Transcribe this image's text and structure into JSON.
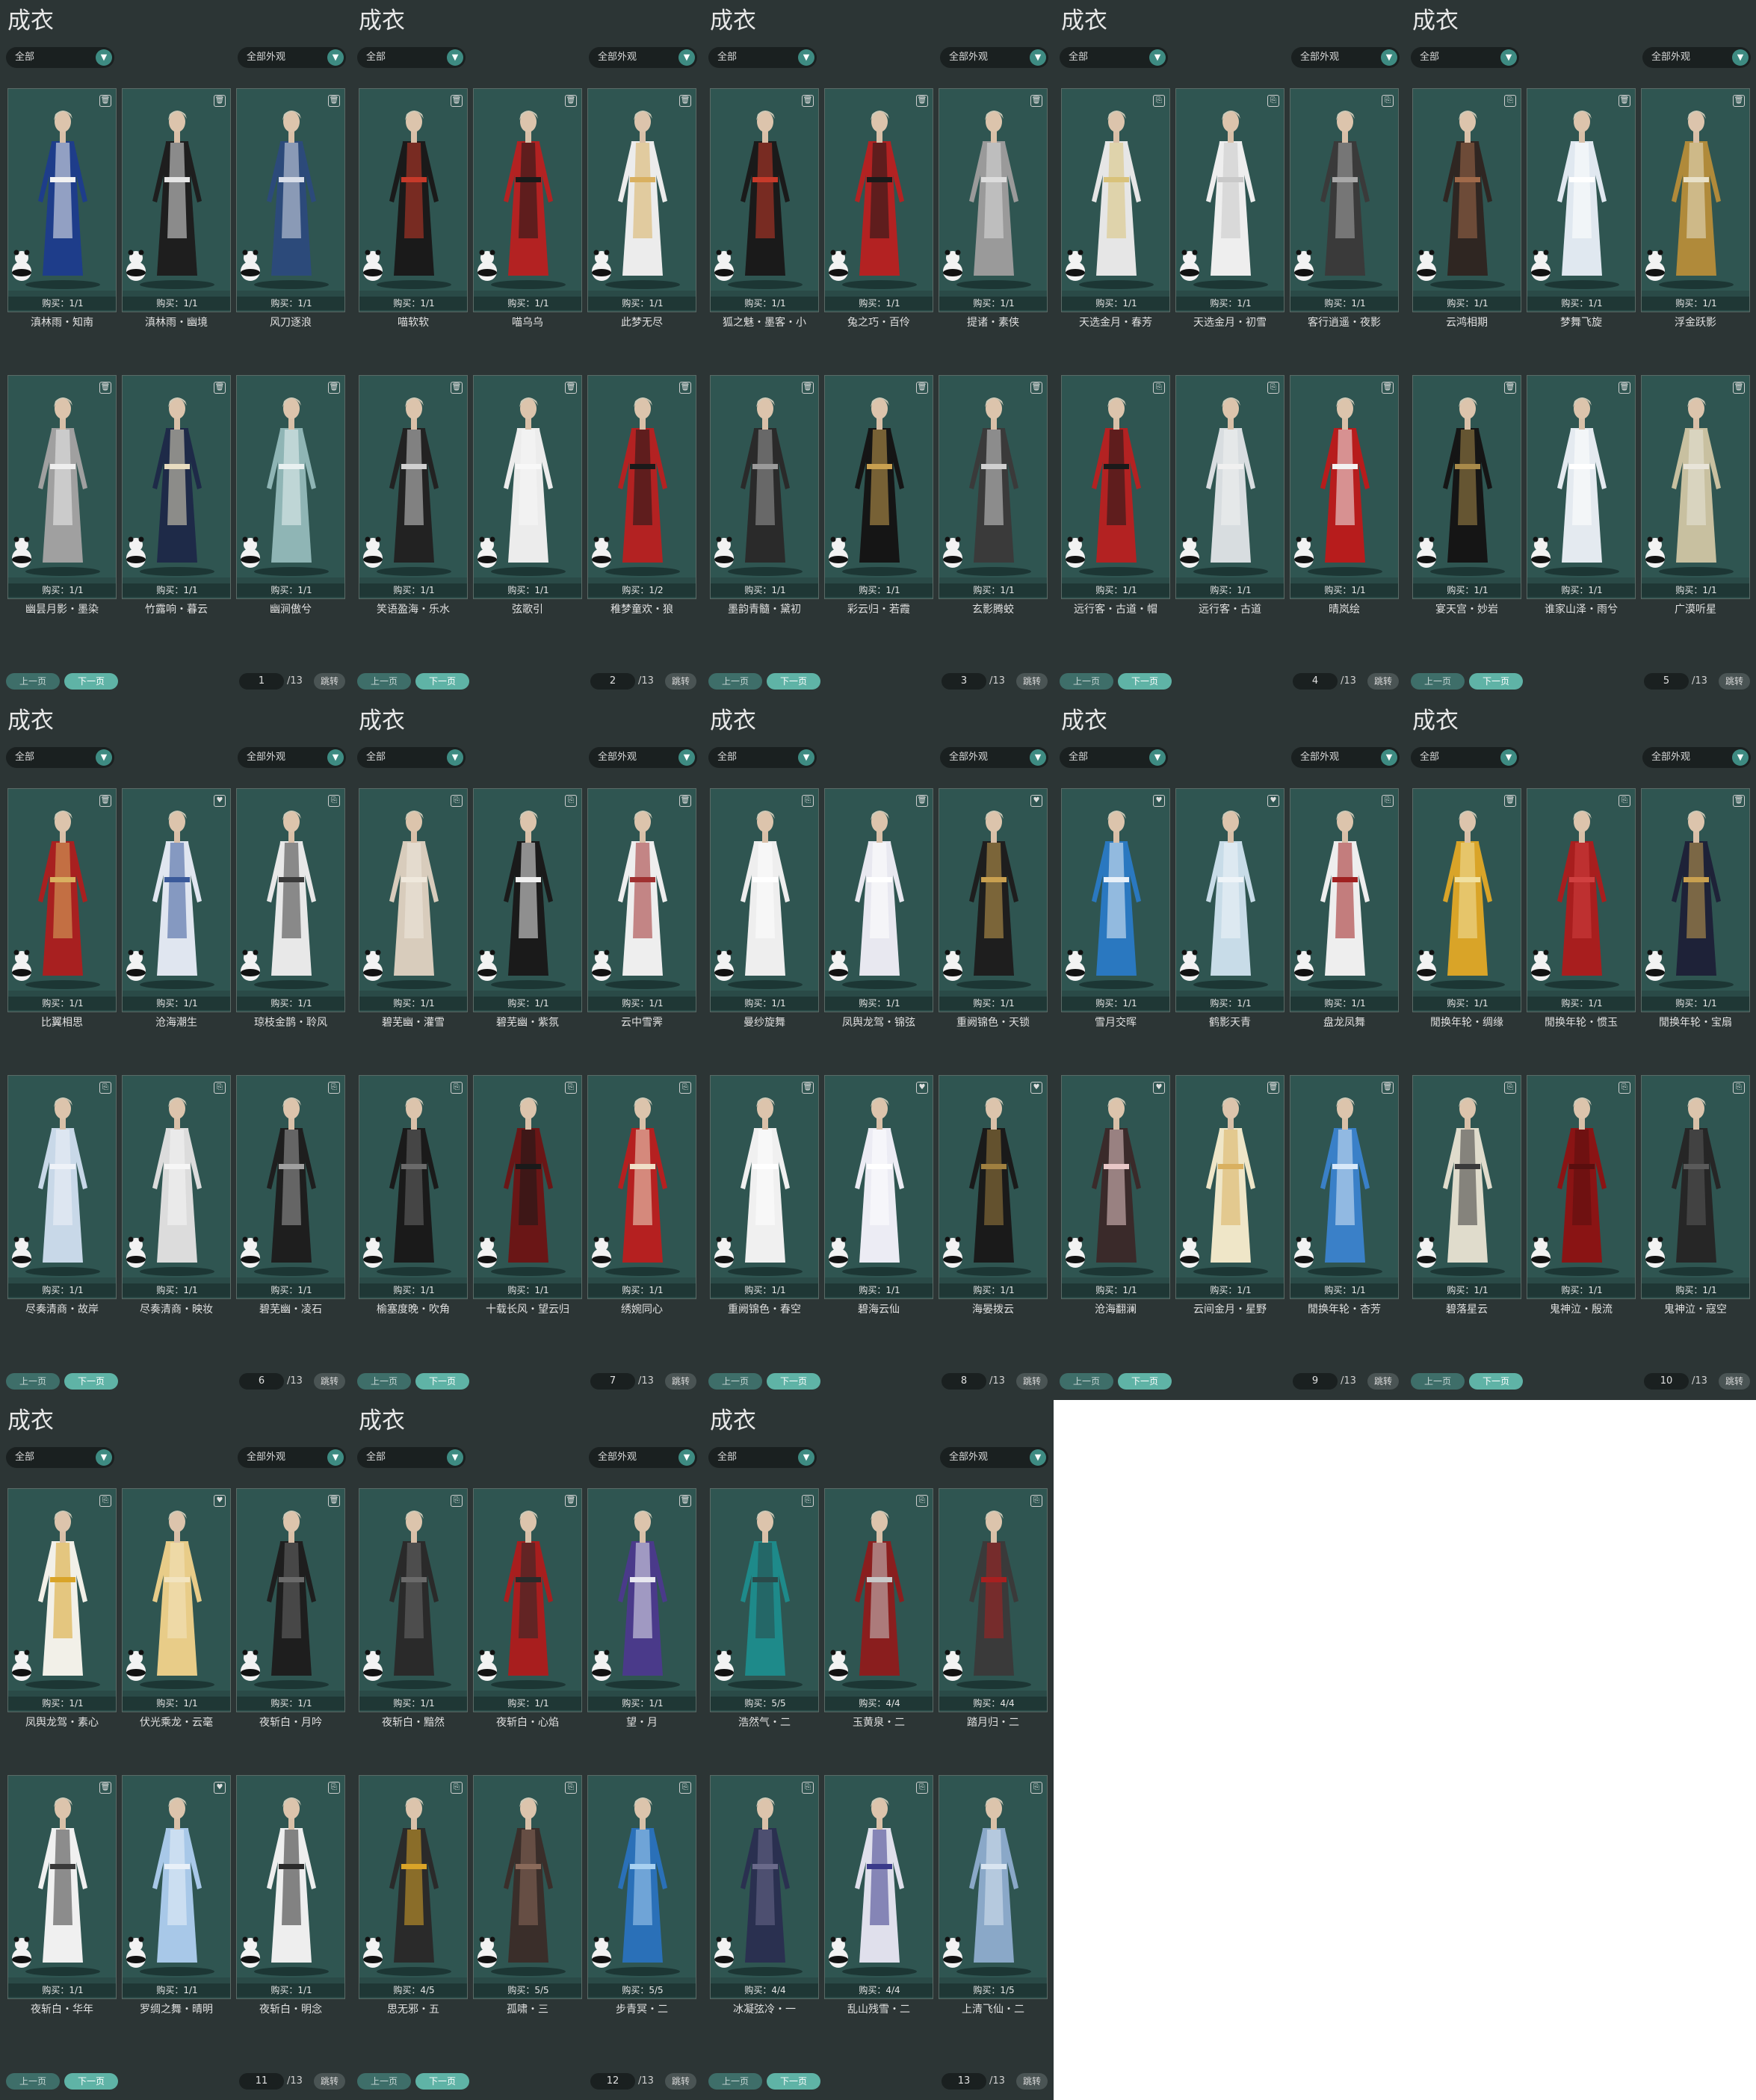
{
  "panel_title": "成衣",
  "filter_left": "全部",
  "filter_right": "全部外观",
  "prev_label": "上一页",
  "next_label": "下一页",
  "jump_label": "跳转",
  "total_pages": "/13",
  "pages": [
    {
      "page": "1",
      "items": [
        {
          "name": "滇林雨・知南",
          "buy": "购买：1/1",
          "outfit": "#1e3d8a",
          "accent": "#f2f2f2",
          "icon": "trash-icon"
        },
        {
          "name": "滇林雨・幽境",
          "buy": "购买：1/1",
          "outfit": "#1e1e1e",
          "accent": "#e5e5e5",
          "icon": "trash-icon"
        },
        {
          "name": "风刀逐浪",
          "buy": "购买：1/1",
          "outfit": "#2c4a7a",
          "accent": "#d8dde8",
          "icon": "trash-icon"
        },
        {
          "name": "幽昙月影・墨染",
          "buy": "购买：1/1",
          "outfit": "#a0a0a0",
          "accent": "#eeeeee",
          "icon": "trash-icon"
        },
        {
          "name": "竹露响・暮云",
          "buy": "购买：1/1",
          "outfit": "#1e2a48",
          "accent": "#e8dcc0",
          "icon": "trash-icon"
        },
        {
          "name": "幽涧傲兮",
          "buy": "购买：1/1",
          "outfit": "#8fb5b5",
          "accent": "#e8f0f0",
          "icon": "trash-icon"
        }
      ]
    },
    {
      "page": "2",
      "items": [
        {
          "name": "喵软软",
          "buy": "购买：1/1",
          "outfit": "#1a1a1a",
          "accent": "#c63a2a",
          "icon": "trash-icon"
        },
        {
          "name": "喵乌乌",
          "buy": "购买：1/1",
          "outfit": "#b32222",
          "accent": "#1a1a1a",
          "icon": "trash-icon"
        },
        {
          "name": "此梦无尽",
          "buy": "购买：1/1",
          "outfit": "#ececec",
          "accent": "#d9b060",
          "icon": "trash-icon"
        },
        {
          "name": "笑语盈海・乐水",
          "buy": "购买：1/1",
          "outfit": "#222222",
          "accent": "#d0d0d0",
          "icon": "trash-icon"
        },
        {
          "name": "弦歌引",
          "buy": "购买：1/1",
          "outfit": "#ececec",
          "accent": "#f8f8f8",
          "icon": "trash-icon"
        },
        {
          "name": "稚梦童欢・狼",
          "buy": "购买：1/2",
          "outfit": "#b32222",
          "accent": "#1a1a1a",
          "icon": "trash-icon"
        }
      ]
    },
    {
      "page": "3",
      "items": [
        {
          "name": "狐之魅・墨客・小",
          "buy": "购买：1/1",
          "outfit": "#1a1a1a",
          "accent": "#c63a2a",
          "icon": "trash-icon"
        },
        {
          "name": "兔之巧・百伶",
          "buy": "购买：1/1",
          "outfit": "#b32222",
          "accent": "#1a1a1a",
          "icon": "trash-icon"
        },
        {
          "name": "提诸・素侠",
          "buy": "购买：1/1",
          "outfit": "#9a9a9a",
          "accent": "#dcdcdc",
          "icon": "trash-icon"
        },
        {
          "name": "墨韵青髓・黛初",
          "buy": "购买：1/1",
          "outfit": "#2a2a2a",
          "accent": "#9a9a9a",
          "icon": "trash-icon"
        },
        {
          "name": "彩云归・若霞",
          "buy": "购买：1/1",
          "outfit": "#151515",
          "accent": "#c9a050",
          "icon": "trash-icon"
        },
        {
          "name": "玄影腾蛟",
          "buy": "购买：1/1",
          "outfit": "#3a3a3a",
          "accent": "#d0d0d0",
          "icon": "trash-icon"
        }
      ]
    },
    {
      "page": "4",
      "items": [
        {
          "name": "天选金月・春芳",
          "buy": "购买：1/1",
          "outfit": "#e6e6e6",
          "accent": "#d9c27a",
          "icon": "tag-icon"
        },
        {
          "name": "天选金月・初雪",
          "buy": "购买：1/1",
          "outfit": "#eeeeee",
          "accent": "#c9c9c9",
          "icon": "tag-icon"
        },
        {
          "name": "客行逍遥・夜影",
          "buy": "购买：1/1",
          "outfit": "#3a3a3a",
          "accent": "#a8a8a8",
          "icon": "tag-icon"
        },
        {
          "name": "远行客・古道・帽",
          "buy": "购买：1/1",
          "outfit": "#b32222",
          "accent": "#1a1a1a",
          "icon": "tag-icon"
        },
        {
          "name": "远行客・古道",
          "buy": "购买：1/1",
          "outfit": "#d8dde0",
          "accent": "#f0f0f0",
          "icon": "tag-icon"
        },
        {
          "name": "晴岚绘",
          "buy": "购买：1/1",
          "outfit": "#b71c1c",
          "accent": "#f2f2f2",
          "icon": "trash-icon"
        }
      ]
    },
    {
      "page": "5",
      "items": [
        {
          "name": "云鸿相期",
          "buy": "购买：1/1",
          "outfit": "#2f2622",
          "accent": "#a06a4a",
          "icon": "tag-icon"
        },
        {
          "name": "梦舞飞旋",
          "buy": "购买：1/1",
          "outfit": "#e0e8f0",
          "accent": "#ffffff",
          "icon": "trash-icon"
        },
        {
          "name": "浮金跃影",
          "buy": "购买：1/1",
          "outfit": "#b08a3a",
          "accent": "#e8e0c8",
          "icon": "trash-icon"
        },
        {
          "name": "宴天宫・妙岩",
          "buy": "购买：1/1",
          "outfit": "#151515",
          "accent": "#a88a4a",
          "icon": "trash-icon"
        },
        {
          "name": "谁家山泽・雨兮",
          "buy": "购买：1/1",
          "outfit": "#e4eaf0",
          "accent": "#ffffff",
          "icon": "trash-icon"
        },
        {
          "name": "广漠听星",
          "buy": "购买：1/1",
          "outfit": "#c8c0a0",
          "accent": "#e8e4d8",
          "icon": "trash-icon"
        }
      ]
    },
    {
      "page": "6",
      "items": [
        {
          "name": "比翼相思",
          "buy": "购买：1/1",
          "outfit": "#a82020",
          "accent": "#d9b060",
          "icon": "trash-icon"
        },
        {
          "name": "沧海潮生",
          "buy": "购买：1/1",
          "outfit": "#e0e6f0",
          "accent": "#3a5a9a",
          "icon": "heart-icon"
        },
        {
          "name": "琼枝金鹊・聆风",
          "buy": "购买：1/1",
          "outfit": "#e8e8e8",
          "accent": "#3a3a3a",
          "icon": "tag-icon"
        },
        {
          "name": "尽奏清商・故岸",
          "buy": "购买：1/1",
          "outfit": "#c8d8e8",
          "accent": "#eef2f8",
          "icon": "tag-icon"
        },
        {
          "name": "尽奏清商・映妆",
          "buy": "购买：1/1",
          "outfit": "#dcdcdc",
          "accent": "#f6f6f6",
          "icon": "tag-icon"
        },
        {
          "name": "碧芜幽・凌石",
          "buy": "购买：1/1",
          "outfit": "#1e1e1e",
          "accent": "#a0a0a0",
          "icon": "tag-icon"
        }
      ]
    },
    {
      "page": "7",
      "items": [
        {
          "name": "碧芜幽・灌雪",
          "buy": "购买：1/1",
          "outfit": "#d8ccbc",
          "accent": "#efe8dc",
          "icon": "tag-icon"
        },
        {
          "name": "碧芜幽・紫氛",
          "buy": "购买：1/1",
          "outfit": "#1a1a1a",
          "accent": "#f0f0f0",
          "icon": "tag-icon"
        },
        {
          "name": "云中雪霁",
          "buy": "购买：1/1",
          "outfit": "#eeeeee",
          "accent": "#a03030",
          "icon": "trash-icon"
        },
        {
          "name": "榆塞度晚・吹角",
          "buy": "购买：1/1",
          "outfit": "#1a1a1a",
          "accent": "#6a6a6a",
          "icon": "tag-icon"
        },
        {
          "name": "十载长风・望云归",
          "buy": "购买：1/1",
          "outfit": "#6a1616",
          "accent": "#1a1a1a",
          "icon": "tag-icon"
        },
        {
          "name": "绣婉同心",
          "buy": "购买：1/1",
          "outfit": "#b52020",
          "accent": "#efe0c8",
          "icon": "tag-icon"
        }
      ]
    },
    {
      "page": "8",
      "items": [
        {
          "name": "曼纱旋舞",
          "buy": "购买：1/1",
          "outfit": "#eeeeee",
          "accent": "#ffffff",
          "icon": "tag-icon"
        },
        {
          "name": "凤舆龙驾・锦弦",
          "buy": "购买：1/1",
          "outfit": "#e8e8f0",
          "accent": "#ffffff",
          "icon": "trash-icon"
        },
        {
          "name": "重阙锦色・天锁",
          "buy": "购买：1/1",
          "outfit": "#1e1e1e",
          "accent": "#c9a050",
          "icon": "heart-icon"
        },
        {
          "name": "重阙锦色・春空",
          "buy": "购买：1/1",
          "outfit": "#f0f0f0",
          "accent": "#ffffff",
          "icon": "trash-icon"
        },
        {
          "name": "碧海云仙",
          "buy": "购买：1/1",
          "outfit": "#ececf4",
          "accent": "#ffffff",
          "icon": "heart-icon"
        },
        {
          "name": "海晏拨云",
          "buy": "购买：1/1",
          "outfit": "#1a1a1a",
          "accent": "#a08040",
          "icon": "heart-icon"
        }
      ]
    },
    {
      "page": "9",
      "items": [
        {
          "name": "雪月交晖",
          "buy": "购买：1/1",
          "outfit": "#2a78c0",
          "accent": "#e8f0f8",
          "icon": "heart-icon"
        },
        {
          "name": "鹤影天青",
          "buy": "购买：1/1",
          "outfit": "#c8dce8",
          "accent": "#eef4f8",
          "icon": "heart-icon"
        },
        {
          "name": "盘龙凤舞",
          "buy": "购买：1/1",
          "outfit": "#eeeeee",
          "accent": "#a02020",
          "icon": "tag-icon"
        },
        {
          "name": "沧海翻澜",
          "buy": "购买：1/1",
          "outfit": "#3a2a2a",
          "accent": "#e8c8c8",
          "icon": "heart-icon"
        },
        {
          "name": "云间金月・星野",
          "buy": "购买：1/1",
          "outfit": "#efe6c8",
          "accent": "#d9b060",
          "icon": "trash-icon"
        },
        {
          "name": "閒换年轮・杏芳",
          "buy": "购买：1/1",
          "outfit": "#3a80c8",
          "accent": "#d8e8f8",
          "icon": "trash-icon"
        }
      ]
    },
    {
      "page": "10",
      "items": [
        {
          "name": "閒换年轮・绸缘",
          "buy": "购买：1/1",
          "outfit": "#d9a428",
          "accent": "#f0e0a0",
          "icon": "trash-icon"
        },
        {
          "name": "閒换年轮・惯玉",
          "buy": "购买：1/1",
          "outfit": "#a81e1e",
          "accent": "#d04040",
          "icon": "tag-icon"
        },
        {
          "name": "閒换年轮・宝扇",
          "buy": "购买：1/1",
          "outfit": "#1e2238",
          "accent": "#c9a050",
          "icon": "trash-icon"
        },
        {
          "name": "碧落星云",
          "buy": "购买：1/1",
          "outfit": "#e0dccc",
          "accent": "#3a3a3a",
          "icon": "tag-icon"
        },
        {
          "name": "鬼神泣・殷流",
          "buy": "购买：1/1",
          "outfit": "#8a1414",
          "accent": "#5a0e0e",
          "icon": "tag-icon"
        },
        {
          "name": "鬼神泣・寇空",
          "buy": "购买：1/1",
          "outfit": "#262626",
          "accent": "#5a5a5a",
          "icon": "tag-icon"
        }
      ]
    },
    {
      "page": "11",
      "items": [
        {
          "name": "凤舆龙驾・素心",
          "buy": "购买：1/1",
          "outfit": "#f2f0e8",
          "accent": "#d9a428",
          "icon": "tag-icon"
        },
        {
          "name": "伏光乘龙・云毫",
          "buy": "购买：1/1",
          "outfit": "#e8cc88",
          "accent": "#f2e4c0",
          "icon": "heart-icon"
        },
        {
          "name": "夜斩白・月吟",
          "buy": "购买：1/1",
          "outfit": "#1e1e1e",
          "accent": "#6a6a6a",
          "icon": "trash-icon"
        },
        {
          "name": "夜斩白・华年",
          "buy": "购买：1/1",
          "outfit": "#f0f0f0",
          "accent": "#3a3a3a",
          "icon": "trash-icon"
        },
        {
          "name": "罗绸之舞・晴明",
          "buy": "购买：1/1",
          "outfit": "#a8c8e8",
          "accent": "#e8f0f8",
          "icon": "heart-icon"
        },
        {
          "name": "夜斩白・明念",
          "buy": "购买：1/1",
          "outfit": "#eeeeee",
          "accent": "#2a2a2a",
          "icon": "tag-icon"
        }
      ]
    },
    {
      "page": "12",
      "items": [
        {
          "name": "夜斩白・黯然",
          "buy": "购买：1/1",
          "outfit": "#2a2a2a",
          "accent": "#6a6a6a",
          "icon": "tag-icon"
        },
        {
          "name": "夜斩白・心焰",
          "buy": "购买：1/1",
          "outfit": "#a81e1e",
          "accent": "#2a2a2a",
          "icon": "trash-icon"
        },
        {
          "name": "望・月",
          "buy": "购买：1/1",
          "outfit": "#4a3a8a",
          "accent": "#e8e8f0",
          "icon": "trash-icon"
        },
        {
          "name": "思无邪・五",
          "buy": "购买：4/5",
          "outfit": "#2a2a2a",
          "accent": "#d9a428",
          "icon": "tag-icon"
        },
        {
          "name": "孤啸・三",
          "buy": "购买：5/5",
          "outfit": "#3a2e2a",
          "accent": "#8a6a5a",
          "icon": "tag-icon"
        },
        {
          "name": "步青冥・二",
          "buy": "购买：5/5",
          "outfit": "#2a70b8",
          "accent": "#a8d0f0",
          "icon": "tag-icon"
        }
      ]
    },
    {
      "page": "13",
      "items": [
        {
          "name": "浩然气・二",
          "buy": "购买：5/5",
          "outfit": "#1e8a8a",
          "accent": "#2a4a4a",
          "icon": "tag-icon"
        },
        {
          "name": "玉黄泉・二",
          "buy": "购买：4/4",
          "outfit": "#8a1e1e",
          "accent": "#c8c8c8",
          "icon": "tag-icon"
        },
        {
          "name": "踏月归・二",
          "buy": "购买：4/4",
          "outfit": "#3a3a3a",
          "accent": "#a82020",
          "icon": "tag-icon"
        },
        {
          "name": "冰凝弦冷・一",
          "buy": "购买：4/4",
          "outfit": "#2a3050",
          "accent": "#6a6a8a",
          "icon": "tag-icon"
        },
        {
          "name": "乱山残雪・二",
          "buy": "购买：4/4",
          "outfit": "#e0e0ec",
          "accent": "#3a3a8a",
          "icon": "tag-icon"
        },
        {
          "name": "上清飞仙・二",
          "buy": "购买：1/5",
          "outfit": "#8aa8c8",
          "accent": "#d8e4f0",
          "icon": "tag-icon"
        }
      ]
    }
  ]
}
